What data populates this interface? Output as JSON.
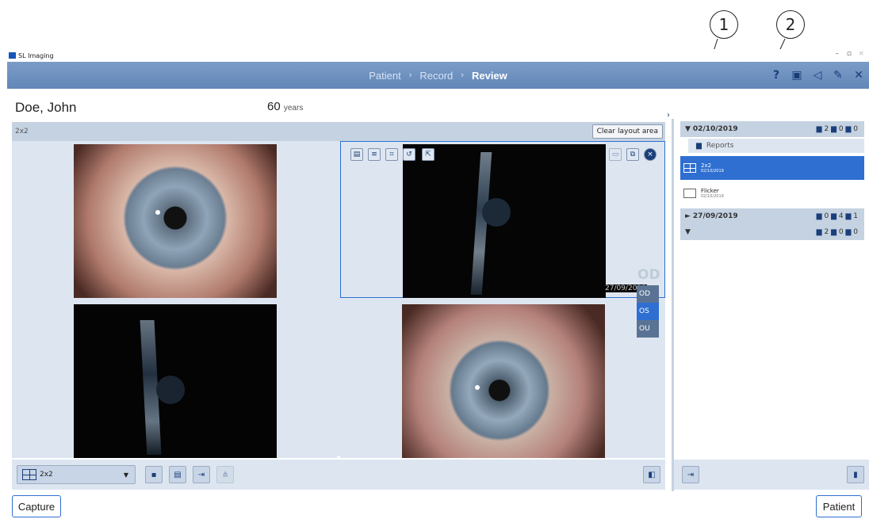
{
  "callouts": [
    "1",
    "2"
  ],
  "window": {
    "title": "SL Imaging",
    "minimize": "–",
    "restore": "▫",
    "close": "×"
  },
  "nav": {
    "steps": [
      "Patient",
      "Record",
      "Review"
    ],
    "separator": "›"
  },
  "patient": {
    "name": "Doe, John",
    "age": "60",
    "age_unit": "years"
  },
  "layout": {
    "name": "2x2",
    "clear_label": "Clear layout area"
  },
  "image_date": "27/09/2019",
  "eye_menu": {
    "options": [
      "OD",
      "OS",
      "OU"
    ],
    "selected": "OS",
    "faded": "OD"
  },
  "toolbar": {
    "layout_value": "2x2"
  },
  "buttons": {
    "capture": "Capture",
    "patient": "Patient"
  },
  "sidebar": {
    "sessions": [
      {
        "date": "02/10/2019",
        "counts": [
          "2",
          "0",
          "0"
        ],
        "expanded": true
      },
      {
        "date": "27/09/2019",
        "counts": [
          "0",
          "4",
          "1"
        ],
        "expanded": false
      },
      {
        "date": "",
        "counts": [
          "2",
          "0",
          "0"
        ],
        "expanded": true
      }
    ],
    "reports_label": "Reports",
    "items": [
      {
        "name": "2x2",
        "date": "02/10/2019",
        "selected": true
      },
      {
        "name": "Flicker",
        "date": "02/10/2019",
        "selected": false
      }
    ]
  },
  "colors": {
    "accent": "#2e6fd1",
    "nav": "#6f91be",
    "panel": "#dde6f0",
    "selected": "#2e6fd1"
  }
}
